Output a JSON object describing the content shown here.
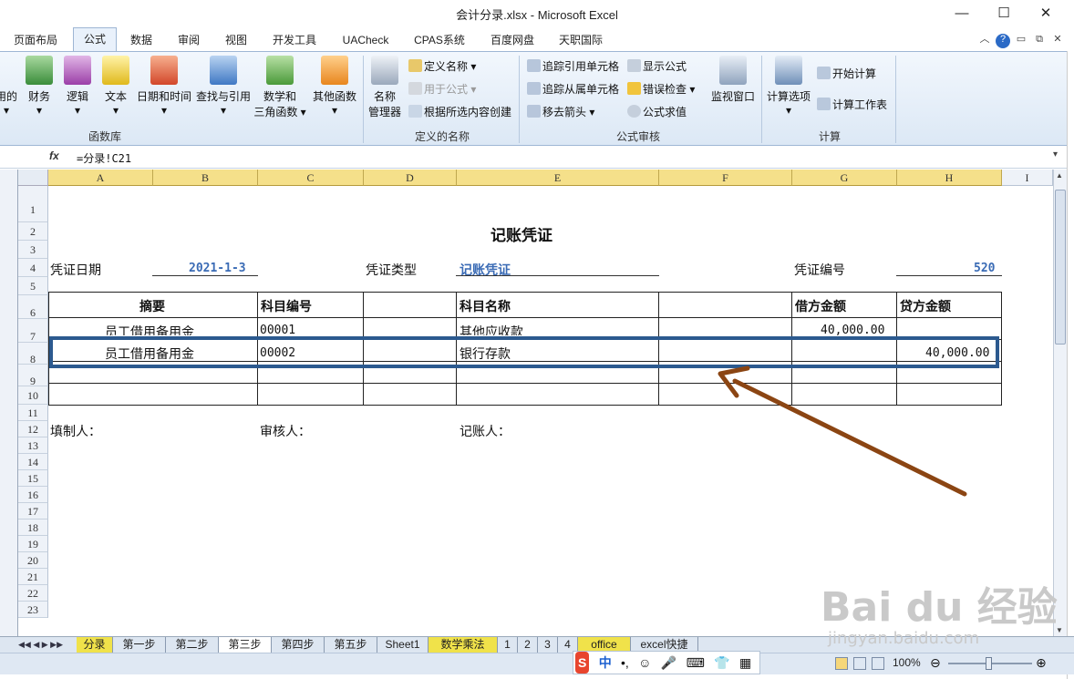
{
  "window": {
    "title": "会计分录.xlsx  -  Microsoft Excel"
  },
  "tabs": [
    "页面布局",
    "公式",
    "数据",
    "审阅",
    "视图",
    "开发工具",
    "UACheck",
    "CPAS系统",
    "百度网盘",
    "天职国际"
  ],
  "active_tab": "公式",
  "ribbon": {
    "function_library": {
      "label": "函数库",
      "buttons": [
        "用的",
        "财务",
        "逻辑",
        "文本",
        "日期和时间",
        "查找与引用",
        "数学和\n三角函数",
        "其他函数"
      ]
    },
    "defined_names": {
      "label": "定义的名称",
      "name_manager": "名称\n管理器",
      "define_name": "定义名称",
      "use_in_formula": "用于公式",
      "create_from_selection": "根据所选内容创建"
    },
    "formula_auditing": {
      "label": "公式审核",
      "trace_precedents": "追踪引用单元格",
      "trace_dependents": "追踪从属单元格",
      "remove_arrows": "移去箭头",
      "show_formulas": "显示公式",
      "error_checking": "错误检查",
      "evaluate_formula": "公式求值",
      "watch_window": "监视窗口"
    },
    "calculation": {
      "label": "计算",
      "calc_options": "计算选项",
      "calc_now": "开始计算",
      "calc_sheet": "计算工作表"
    }
  },
  "formula_bar": {
    "fx": "fx",
    "formula": "=分录!C21"
  },
  "columns": [
    "A",
    "B",
    "C",
    "D",
    "E",
    "F",
    "G",
    "H",
    "I"
  ],
  "rows": [
    "1",
    "2",
    "3",
    "4",
    "5",
    "6",
    "7",
    "8",
    "9",
    "10",
    "11",
    "12",
    "13",
    "14",
    "15",
    "16",
    "17",
    "18",
    "19",
    "20",
    "21",
    "22",
    "23"
  ],
  "voucher": {
    "title": "记账凭证",
    "date_label": "凭证日期",
    "date_value": "2021-1-3",
    "type_label": "凭证类型",
    "type_value": "记账凭证",
    "number_label": "凭证编号",
    "number_value": "520",
    "headers": {
      "summary": "摘要",
      "account_code": "科目编号",
      "account_name": "科目名称",
      "debit": "借方金额",
      "credit": "贷方金额"
    },
    "lines": [
      {
        "summary": "员工借用备用金",
        "code": "00001",
        "name": "其他应收款",
        "debit": "40,000.00",
        "credit": ""
      },
      {
        "summary": "员工借用备用金",
        "code": "00002",
        "name": "银行存款",
        "debit": "",
        "credit": "40,000.00"
      }
    ],
    "preparer": "填制人：",
    "reviewer": "审核人：",
    "bookkeeper": "记账人："
  },
  "sheet_tabs": [
    "分录",
    "第一步",
    "第二步",
    "第三步",
    "第四步",
    "第五步",
    "Sheet1",
    "数学乘法",
    "1",
    "2",
    "3",
    "4",
    "office",
    "excel快捷"
  ],
  "active_sheet": "第三步",
  "status": {
    "zoom": "100%"
  },
  "ime": {
    "lang": "中"
  },
  "colors": {
    "highlight_box": "#2c5a8f",
    "arrow": "#8b4513",
    "header_yellow": "#f5e08a"
  },
  "watermark": {
    "main": "Bai du 经验",
    "sub": "jingyan.baidu.com"
  }
}
